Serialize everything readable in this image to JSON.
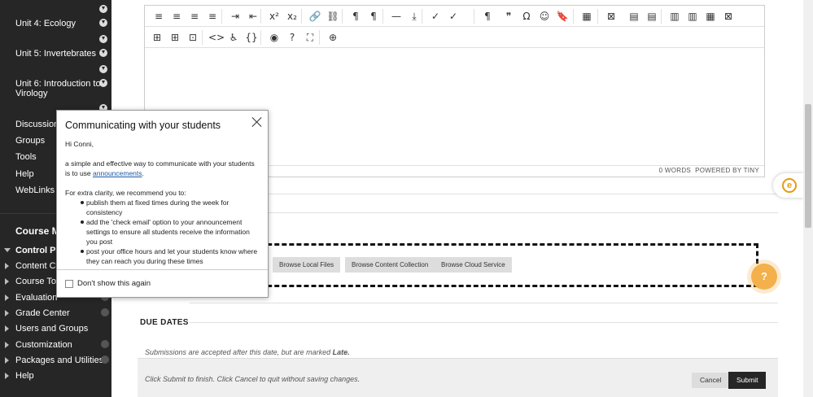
{
  "sidebar": {
    "units": [
      {
        "label": "Unit 4: Ecology"
      },
      {
        "label": "Unit 5: Invertebrates"
      },
      {
        "label": "Unit 6: Introduction to"
      },
      {
        "label": "Virology"
      }
    ],
    "tools": [
      "Discussions",
      "Groups",
      "Tools",
      "Help",
      "WebLinks"
    ],
    "course_management_title": "Course Mar",
    "control_panel": [
      {
        "label": "Control Par"
      },
      {
        "label": "Content Colle"
      },
      {
        "label": "Course Tools"
      },
      {
        "label": "Evaluation"
      },
      {
        "label": "Grade Center"
      },
      {
        "label": "Users and Groups"
      },
      {
        "label": "Customization"
      },
      {
        "label": "Packages and Utilities"
      },
      {
        "label": "Help"
      }
    ]
  },
  "editor": {
    "word_count": "0 WORDS",
    "powered_by": "POWERED BY TINY",
    "row1_icons": [
      "align-left-icon",
      "align-center-icon",
      "align-right-icon",
      "align-justify-icon",
      "indent-icon",
      "outdent-icon",
      "superscript-icon",
      "subscript-icon",
      "link-icon",
      "unlink-icon",
      "ltr-icon",
      "rtl-icon",
      "hr-icon",
      "insert-icon",
      "spellcheck-icon",
      "accessibility-check-icon",
      "paragraph-icon",
      "blockquote-icon",
      "special-char-icon",
      "emoji-icon",
      "bookmark-icon",
      "table-icon",
      "table-delete-icon",
      "table-row-before-icon",
      "table-row-after-icon",
      "table-col-before-icon",
      "table-col-after-icon",
      "table-insert-col-icon",
      "table-delete-col-icon"
    ],
    "row1_glyphs": [
      "≡",
      "≡",
      "≡",
      "≡",
      "⇥",
      "⇤",
      "x²",
      "x₂",
      "🔗",
      "⛓",
      "¶",
      "¶",
      "—",
      "⤓",
      "✓",
      "✓",
      "¶",
      "❞",
      "Ω",
      "☺",
      "🔖",
      "▦",
      "⊠",
      "▤",
      "▤",
      "▥",
      "▥",
      "▦",
      "⊠"
    ],
    "row2_icons": [
      "table-row-props-icon",
      "table-cell-props-icon",
      "table-merge-icon",
      "code-icon",
      "accessibility-icon",
      "source-code-icon",
      "preview-icon",
      "help-icon",
      "fullscreen-icon",
      "add-content-icon"
    ],
    "row2_glyphs": [
      "⊞",
      "⊞",
      "⊡",
      "<>",
      "♿",
      "{}",
      "◉",
      "?",
      "⛶",
      "⊕"
    ]
  },
  "attachments": {
    "browse_local": "Browse Local Files",
    "browse_content": "Browse Content Collection",
    "browse_cloud": "Browse Cloud Service"
  },
  "due_dates": {
    "title": "DUE DATES",
    "note_prefix": "Submissions are accepted after this date, but are marked ",
    "note_emphasis": "Late."
  },
  "submit_bar": {
    "note": "Click Submit to finish. Click Cancel to quit without saving changes.",
    "cancel": "Cancel",
    "submit": "Submit"
  },
  "help_fab": "?",
  "popup": {
    "title": "Communicating with your students",
    "greeting": "Hi Conni,",
    "intro_prefix": "a simple and effective way to communicate with your students is to use ",
    "intro_link": "announcements",
    "intro_suffix": ".",
    "recommend": "For extra clarity, we recommend you to:",
    "bullets": [
      "publish them at fixed times during the week for consistency",
      "add the 'check email' option to your announcement settings to ensure all students receive the information you post",
      "post your office hours and let your students know where they can reach you during these times"
    ],
    "dont_show": "Don't show this again"
  },
  "colors": {
    "sidebar_bg": "#262626",
    "accent_orange": "#f4b04a",
    "link": "#1a5aa6"
  }
}
